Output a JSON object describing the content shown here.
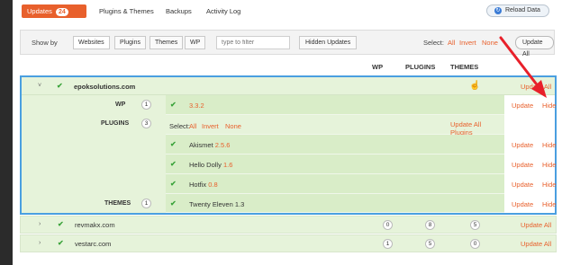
{
  "tabs": {
    "updates_label": "Updates",
    "updates_count": "24",
    "plugins_themes": "Plugins & Themes",
    "backups": "Backups",
    "activity_log": "Activity Log",
    "reload": "Reload Data"
  },
  "filter": {
    "show_by": "Show by",
    "segments": [
      "Websites",
      "Plugins",
      "Themes",
      "WP"
    ],
    "placeholder": "type to filter",
    "hidden_updates": "Hidden Updates",
    "select_label": "Select:",
    "select_all": "All",
    "select_invert": "Invert",
    "select_none": "None",
    "update_all": "Update All"
  },
  "columns": {
    "wp": "WP",
    "plugins": "PLUGINS",
    "themes": "THEMES"
  },
  "expanded_site": {
    "name": "epoksolutions.com",
    "update_all": "Update All",
    "wp": {
      "label": "WP",
      "count": "1",
      "version": "3.3.2",
      "update": "Update",
      "hide": "Hide"
    },
    "plugins": {
      "label": "PLUGINS",
      "count": "3",
      "select_label": "Select:",
      "select_all": "All",
      "select_invert": "Invert",
      "select_none": "None",
      "update_all_plugins": "Update All Plugins",
      "items": [
        {
          "name": "Akismet",
          "version": "2.5.6",
          "update": "Update",
          "hide": "Hide"
        },
        {
          "name": "Hello Dolly",
          "version": "1.6",
          "update": "Update",
          "hide": "Hide"
        },
        {
          "name": "Hotfix",
          "version": "0.8",
          "update": "Update",
          "hide": "Hide"
        }
      ]
    },
    "themes": {
      "label": "THEMES",
      "count": "1",
      "items": [
        {
          "name": "Twenty Eleven",
          "version": "1.3",
          "update": "Update",
          "hide": "Hide"
        }
      ]
    }
  },
  "sites": [
    {
      "name": "revmakx.com",
      "wp": "0",
      "plugins": "8",
      "themes": "5",
      "update_all": "Update All"
    },
    {
      "name": "vestarc.com",
      "wp": "1",
      "plugins": "5",
      "themes": "0",
      "update_all": "Update All"
    }
  ],
  "colors": {
    "accent": "#e8602c",
    "highlight": "#4a9fe0",
    "row_bg": "#e6f3da",
    "arrow": "#e8202a"
  },
  "icons": {
    "reload": "reload-icon",
    "check": "checkmark-icon",
    "chevron": "chevron-icon",
    "cursor": "hand-cursor-icon"
  }
}
